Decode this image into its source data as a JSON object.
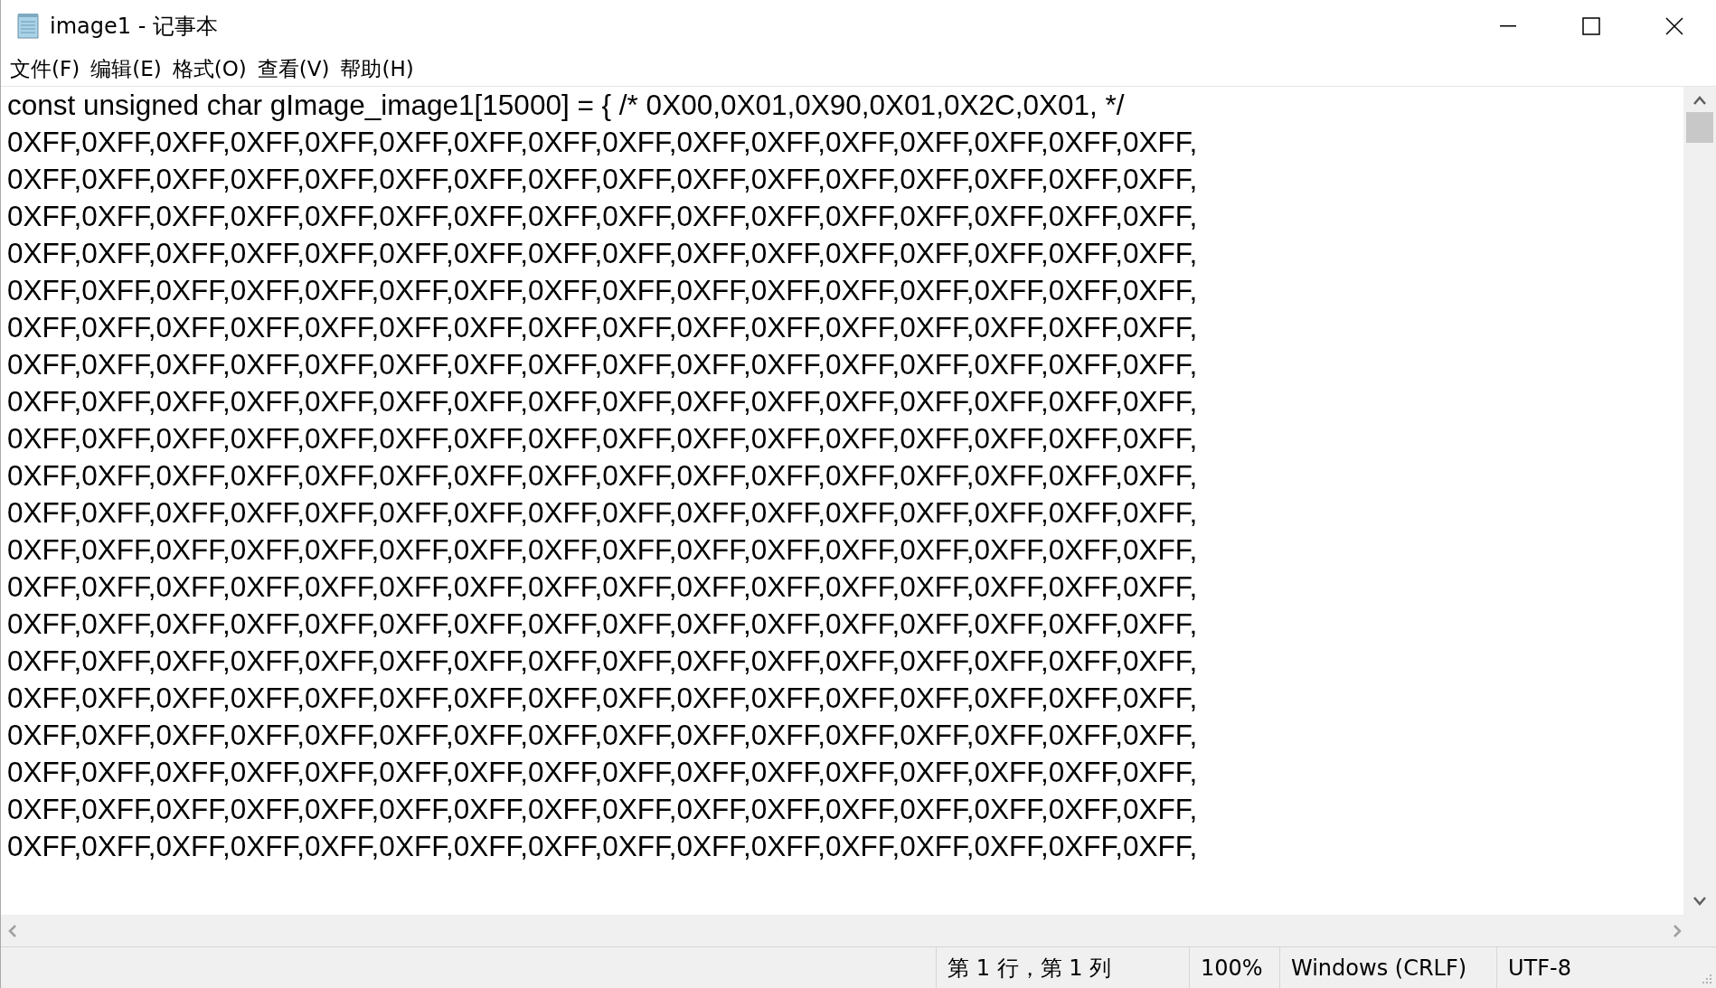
{
  "window": {
    "title": "image1 - 记事本"
  },
  "menu": [
    "文件(F)",
    "编辑(E)",
    "格式(O)",
    "查看(V)",
    "帮助(H)"
  ],
  "editor": {
    "lines": [
      "const unsigned char gImage_image1[15000] = { /* 0X00,0X01,0X90,0X01,0X2C,0X01, */",
      "0XFF,0XFF,0XFF,0XFF,0XFF,0XFF,0XFF,0XFF,0XFF,0XFF,0XFF,0XFF,0XFF,0XFF,0XFF,0XFF,",
      "0XFF,0XFF,0XFF,0XFF,0XFF,0XFF,0XFF,0XFF,0XFF,0XFF,0XFF,0XFF,0XFF,0XFF,0XFF,0XFF,",
      "0XFF,0XFF,0XFF,0XFF,0XFF,0XFF,0XFF,0XFF,0XFF,0XFF,0XFF,0XFF,0XFF,0XFF,0XFF,0XFF,",
      "0XFF,0XFF,0XFF,0XFF,0XFF,0XFF,0XFF,0XFF,0XFF,0XFF,0XFF,0XFF,0XFF,0XFF,0XFF,0XFF,",
      "0XFF,0XFF,0XFF,0XFF,0XFF,0XFF,0XFF,0XFF,0XFF,0XFF,0XFF,0XFF,0XFF,0XFF,0XFF,0XFF,",
      "0XFF,0XFF,0XFF,0XFF,0XFF,0XFF,0XFF,0XFF,0XFF,0XFF,0XFF,0XFF,0XFF,0XFF,0XFF,0XFF,",
      "0XFF,0XFF,0XFF,0XFF,0XFF,0XFF,0XFF,0XFF,0XFF,0XFF,0XFF,0XFF,0XFF,0XFF,0XFF,0XFF,",
      "0XFF,0XFF,0XFF,0XFF,0XFF,0XFF,0XFF,0XFF,0XFF,0XFF,0XFF,0XFF,0XFF,0XFF,0XFF,0XFF,",
      "0XFF,0XFF,0XFF,0XFF,0XFF,0XFF,0XFF,0XFF,0XFF,0XFF,0XFF,0XFF,0XFF,0XFF,0XFF,0XFF,",
      "0XFF,0XFF,0XFF,0XFF,0XFF,0XFF,0XFF,0XFF,0XFF,0XFF,0XFF,0XFF,0XFF,0XFF,0XFF,0XFF,",
      "0XFF,0XFF,0XFF,0XFF,0XFF,0XFF,0XFF,0XFF,0XFF,0XFF,0XFF,0XFF,0XFF,0XFF,0XFF,0XFF,",
      "0XFF,0XFF,0XFF,0XFF,0XFF,0XFF,0XFF,0XFF,0XFF,0XFF,0XFF,0XFF,0XFF,0XFF,0XFF,0XFF,",
      "0XFF,0XFF,0XFF,0XFF,0XFF,0XFF,0XFF,0XFF,0XFF,0XFF,0XFF,0XFF,0XFF,0XFF,0XFF,0XFF,",
      "0XFF,0XFF,0XFF,0XFF,0XFF,0XFF,0XFF,0XFF,0XFF,0XFF,0XFF,0XFF,0XFF,0XFF,0XFF,0XFF,",
      "0XFF,0XFF,0XFF,0XFF,0XFF,0XFF,0XFF,0XFF,0XFF,0XFF,0XFF,0XFF,0XFF,0XFF,0XFF,0XFF,",
      "0XFF,0XFF,0XFF,0XFF,0XFF,0XFF,0XFF,0XFF,0XFF,0XFF,0XFF,0XFF,0XFF,0XFF,0XFF,0XFF,",
      "0XFF,0XFF,0XFF,0XFF,0XFF,0XFF,0XFF,0XFF,0XFF,0XFF,0XFF,0XFF,0XFF,0XFF,0XFF,0XFF,",
      "0XFF,0XFF,0XFF,0XFF,0XFF,0XFF,0XFF,0XFF,0XFF,0XFF,0XFF,0XFF,0XFF,0XFF,0XFF,0XFF,",
      "0XFF,0XFF,0XFF,0XFF,0XFF,0XFF,0XFF,0XFF,0XFF,0XFF,0XFF,0XFF,0XFF,0XFF,0XFF,0XFF,",
      "0XFF,0XFF,0XFF,0XFF,0XFF,0XFF,0XFF,0XFF,0XFF,0XFF,0XFF,0XFF,0XFF,0XFF,0XFF,0XFF,"
    ]
  },
  "status_bar": [
    "第 1 行，第 1 列",
    "100%",
    "Windows (CRLF)",
    "UTF-8"
  ]
}
